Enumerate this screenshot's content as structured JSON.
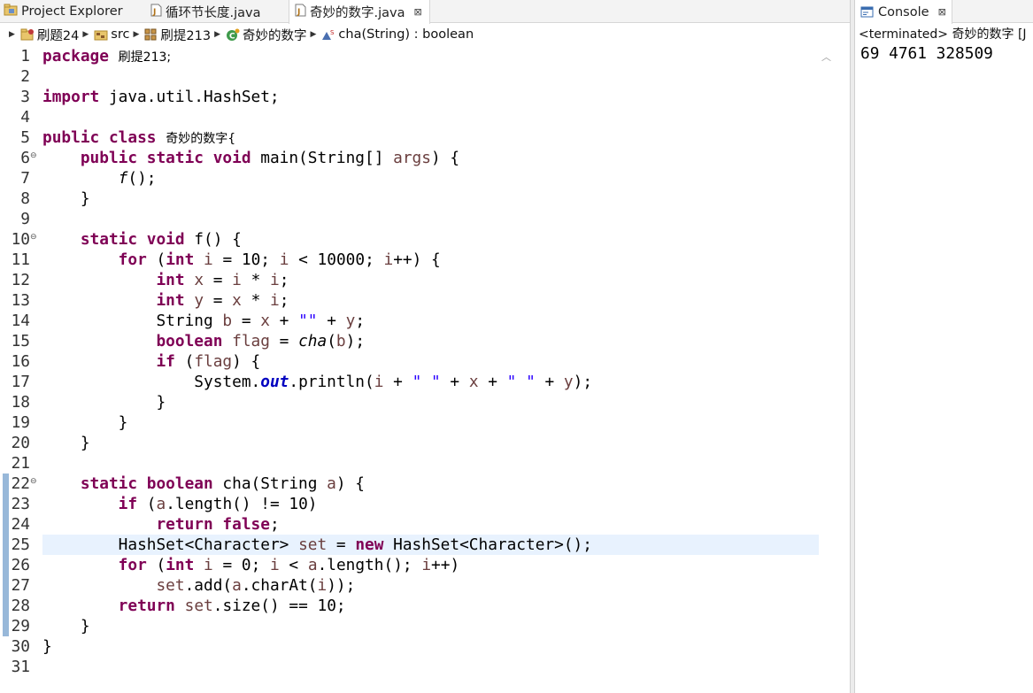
{
  "tabs": {
    "project_explorer": "Project Explorer",
    "loop_file": "循环节长度.java",
    "active_file": "奇妙的数字.java",
    "close_glyph": "⊠"
  },
  "breadcrumb": {
    "project": "刷题24",
    "folder": "src",
    "package": "刷提213",
    "class": "奇妙的数字",
    "method": "cha(String) : boolean"
  },
  "line_numbers": [
    "1",
    "2",
    "3",
    "4",
    "5",
    "6",
    "7",
    "8",
    "9",
    "10",
    "11",
    "12",
    "13",
    "14",
    "15",
    "16",
    "17",
    "18",
    "19",
    "20",
    "21",
    "22",
    "23",
    "24",
    "25",
    "26",
    "27",
    "28",
    "29",
    "30",
    "31"
  ],
  "code": {
    "package_kw": "package",
    "package_name": "刷提213;",
    "import_line": "import java.util.HashSet;",
    "import_kw": "import",
    "import_rest": " java.util.HashSet;",
    "public_kw": "public",
    "class_kw": "class",
    "class_name": "奇妙的数字{",
    "l6_mods": "public static void",
    "l6_rest": " main(String[] ",
    "l6_args": "args",
    "l6_end": ") {",
    "l7_call": "f",
    "l7_end": "();",
    "close_brace": "}",
    "l10_mods": "static void",
    "l10_rest": " f() {",
    "l11_for": "for",
    "l11_a": " (",
    "l11_int": "int",
    "l11_b": " ",
    "l11_i": "i",
    "l11_c": " = 10; ",
    "l11_i2": "i",
    "l11_d": " < 10000; ",
    "l11_i3": "i",
    "l11_e": "++) {",
    "l12_int": "int",
    "l12_x": "x",
    "l12_eq": " = ",
    "l12_i": "i",
    "l12_mul": " * ",
    "l12_i2": "i",
    "l12_end": ";",
    "l13_y": "y",
    "l13_x": "x",
    "l14_type": "String ",
    "l14_b": "b",
    "l14_eq": " = ",
    "l14_x": "x",
    "l14_plus": " + ",
    "l14_str": "\"\"",
    "l14_plus2": " + ",
    "l14_y": "y",
    "l14_end": ";",
    "l15_bool": "boolean",
    "l15_flag": "flag",
    "l15_eq": " = ",
    "l15_cha": "cha",
    "l15_paren": "(",
    "l15_b": "b",
    "l15_end": ");",
    "l16_if": "if",
    "l16_a": " (",
    "l16_flag": "flag",
    "l16_end": ") {",
    "l17_sys": "System.",
    "l17_out": "out",
    "l17_println": ".println(",
    "l17_i": "i",
    "l17_p1": " + ",
    "l17_s1": "\" \"",
    "l17_p2": " + ",
    "l17_x": "x",
    "l17_p3": " + ",
    "l17_s2": "\" \"",
    "l17_p4": " + ",
    "l17_y": "y",
    "l17_end": ");",
    "l22_mods": "static boolean",
    "l22_rest": " cha(String ",
    "l22_a": "a",
    "l22_end": ") {",
    "l23_if": "if",
    "l23_a0": " (",
    "l23_a": "a",
    "l23_rest": ".length() != 10)",
    "l24_return": "return",
    "l24_false": "false",
    "l24_end": ";",
    "l25_type": "HashSet<Character> ",
    "l25_set": "set",
    "l25_eq": " = ",
    "l25_new": "new",
    "l25_rest": " HashSet<Character>();",
    "l26_for": "for",
    "l26_a0": " (",
    "l26_int": "int",
    "l26_i": "i",
    "l26_c": " = 0; ",
    "l26_i2": "i",
    "l26_d": " < ",
    "l26_a": "a",
    "l26_e": ".length(); ",
    "l26_i3": "i",
    "l26_f": "++)",
    "l27_set": "set",
    "l27_add": ".add(",
    "l27_a": "a",
    "l27_char": ".charAt(",
    "l27_i": "i",
    "l27_end": "));",
    "l28_return": "return",
    "l28_set": "set",
    "l28_rest": ".size() == 10;"
  },
  "console": {
    "tab_label": "Console",
    "close_glyph": "⊠",
    "status": "<terminated> 奇妙的数字 [J",
    "output": "69 4761 328509"
  },
  "icons": {
    "project_explorer": "project-explorer-icon",
    "java_file": "java-file-icon",
    "project": "project-icon",
    "src_folder": "source-folder-icon",
    "package": "package-icon",
    "class": "class-icon",
    "method": "method-icon",
    "console": "console-icon"
  },
  "colors": {
    "keyword": "#7f0055",
    "variable": "#6a3e3e",
    "string": "#2a00ff",
    "field": "#0000c0",
    "current_line": "#e8f2fe"
  }
}
